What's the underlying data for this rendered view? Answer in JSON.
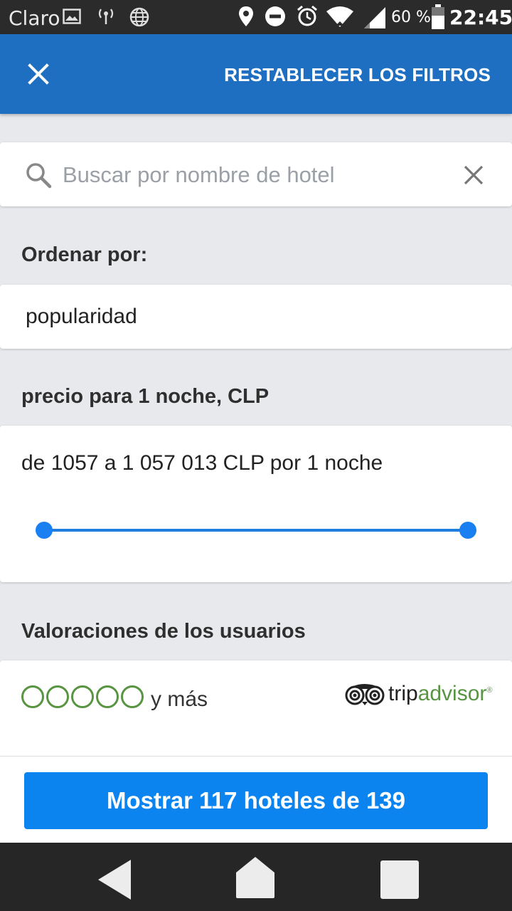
{
  "status_bar": {
    "carrier": "Claro",
    "battery": "60 %",
    "time": "22:45",
    "icons": [
      "image-icon",
      "antenna-icon",
      "globe-icon",
      "location-icon",
      "dnd-icon",
      "alarm-icon",
      "wifi-icon",
      "signal-icon",
      "battery-icon"
    ]
  },
  "app_bar": {
    "close_icon": "close-icon",
    "reset_label": "RESTABLECER LOS FILTROS",
    "background": "#1e6fc1"
  },
  "search": {
    "placeholder": "Buscar por nombre de hotel",
    "value": ""
  },
  "sort": {
    "label": "Ordenar por:",
    "value": "popularidad"
  },
  "price": {
    "label": "precio para 1 noche, CLP",
    "range_text": "de 1057 a 1 057 013 CLP por 1 noche",
    "min": 1057,
    "max": 1057013,
    "selected_min": 1057,
    "selected_max": 1057013
  },
  "ratings": {
    "label": "Valoraciones de los usuarios",
    "circles": 5,
    "filled": 0,
    "suffix": "y más",
    "brand_part1": "trip",
    "brand_part2": "advisor",
    "brand_mark": "®",
    "circle_color": "#589442"
  },
  "cta": {
    "label": "Mostrar 117 hoteles de 139",
    "color": "#0b84f0"
  },
  "nav": {
    "back": "back-icon",
    "home": "home-icon",
    "recents": "recents-icon"
  }
}
